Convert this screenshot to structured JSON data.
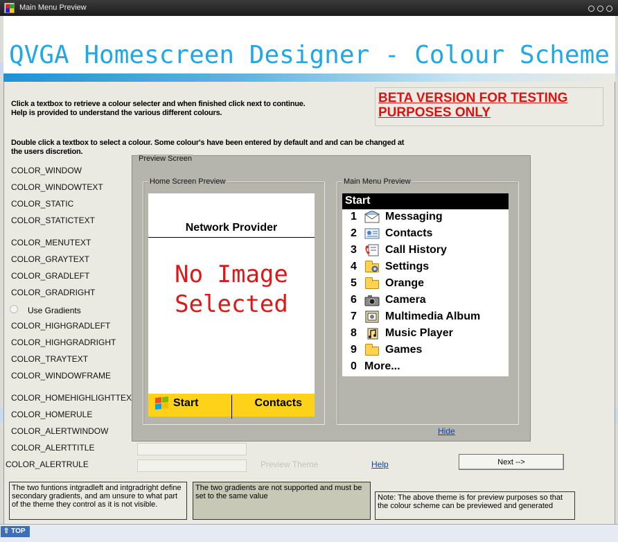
{
  "window": {
    "title": "Main Menu Preview",
    "heading": "QVGA Homescreen Designer - Colour Scheme"
  },
  "instructions": {
    "line1": "Click a textbox to retrieve a colour selecter and when finished click next to continue.",
    "line2": "Help is provided to understand the various different colours.",
    "double_click1": "Double click a textbox to select a colour. Some colour's have been entered by default and and can be changed at",
    "double_click2": "the users discretion."
  },
  "beta_notice": "BETA VERSION FOR TESTING PURPOSES ONLY",
  "color_fields": [
    "COLOR_WINDOW",
    "COLOR_WINDOWTEXT",
    "COLOR_STATIC",
    "COLOR_STATICTEXT",
    "COLOR_MENUTEXT",
    "COLOR_GRAYTEXT",
    "COLOR_GRADLEFT",
    "COLOR_GRADRIGHT",
    "COLOR_HIGHGRADLEFT",
    "COLOR_HIGHGRADRIGHT",
    "COLOR_TRAYTEXT",
    "COLOR_WINDOWFRAME",
    "COLOR_HOMEHIGHLIGHTTEXT",
    "COLOR_HOMERULE",
    "COLOR_ALERTWINDOW",
    "COLOR_ALERTTITLE",
    "COLOR_ALERTRULE"
  ],
  "use_gradients_label": "Use Gradients",
  "preview": {
    "group_label": "Preview Screen",
    "home_label": "Home Screen Preview",
    "menu_label": "Main Menu Preview",
    "network_provider": "Network Provider",
    "no_image_line1": "No Image",
    "no_image_line2": "Selected",
    "tray_start": "Start",
    "tray_contacts": "Contacts",
    "menu_header": "Start",
    "menu_items": [
      {
        "num": "1",
        "label": "Messaging",
        "icon": "envelope-icon"
      },
      {
        "num": "2",
        "label": "Contacts",
        "icon": "contact-card-icon"
      },
      {
        "num": "3",
        "label": "Call History",
        "icon": "phone-icon"
      },
      {
        "num": "4",
        "label": "Settings",
        "icon": "settings-folder-icon"
      },
      {
        "num": "5",
        "label": "Orange",
        "icon": "folder-icon"
      },
      {
        "num": "6",
        "label": "Camera",
        "icon": "camera-icon"
      },
      {
        "num": "7",
        "label": "Multimedia Album",
        "icon": "album-icon"
      },
      {
        "num": "8",
        "label": "Music Player",
        "icon": "music-icon"
      },
      {
        "num": "9",
        "label": "Games",
        "icon": "folder-icon"
      },
      {
        "num": "0",
        "label": "More...",
        "icon": ""
      }
    ]
  },
  "links": {
    "hide": "Hide",
    "help": "Help",
    "preview_theme": "Preview Theme"
  },
  "buttons": {
    "next": "Next -->",
    "top": "TOP"
  },
  "notes": {
    "gradients_info": "The two funtions intgradleft and intgradright define secondary gradients, and am unsure to what part of the theme they control as it is not visible.",
    "gradients_unsupported": "The two gradients are not supported and must be set to the same value",
    "preview_note": "Note: The above theme is for preview purposes so that the colour scheme can be previewed and generated"
  },
  "colors": {
    "heading": "#20a7e6",
    "beta": "#e01010",
    "tray": "#ffd21a",
    "no_image": "#dd1818"
  }
}
